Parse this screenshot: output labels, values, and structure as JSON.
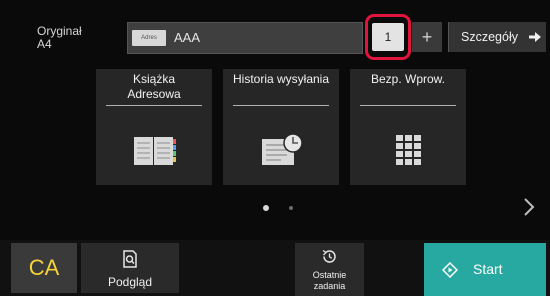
{
  "original": {
    "label": "Oryginał",
    "size": "A4"
  },
  "destination": {
    "tag": "Adres",
    "value": "AAA"
  },
  "copies": {
    "count": "1",
    "plus_label": "+"
  },
  "details": {
    "label": "Szczegóły",
    "icon": "arrow-right-icon"
  },
  "cards": [
    {
      "title_line1": "Książka",
      "title_line2": "Adresowa",
      "icon": "address-book-icon"
    },
    {
      "title_line1": "Historia wysyłania",
      "icon": "send-history-icon"
    },
    {
      "title_line1": "Bezp. Wprow.",
      "icon": "keypad-icon"
    }
  ],
  "pagination": {
    "pages": 2,
    "current": 1
  },
  "bottom": {
    "ca_label": "CA",
    "preview_label": "Podgląd",
    "recent_line1": "Ostatnie",
    "recent_line2": "zadania",
    "start_label": "Start"
  },
  "colors": {
    "highlight": "#e0143c",
    "start": "#27a8a0",
    "ca_text": "#f5d23c"
  }
}
